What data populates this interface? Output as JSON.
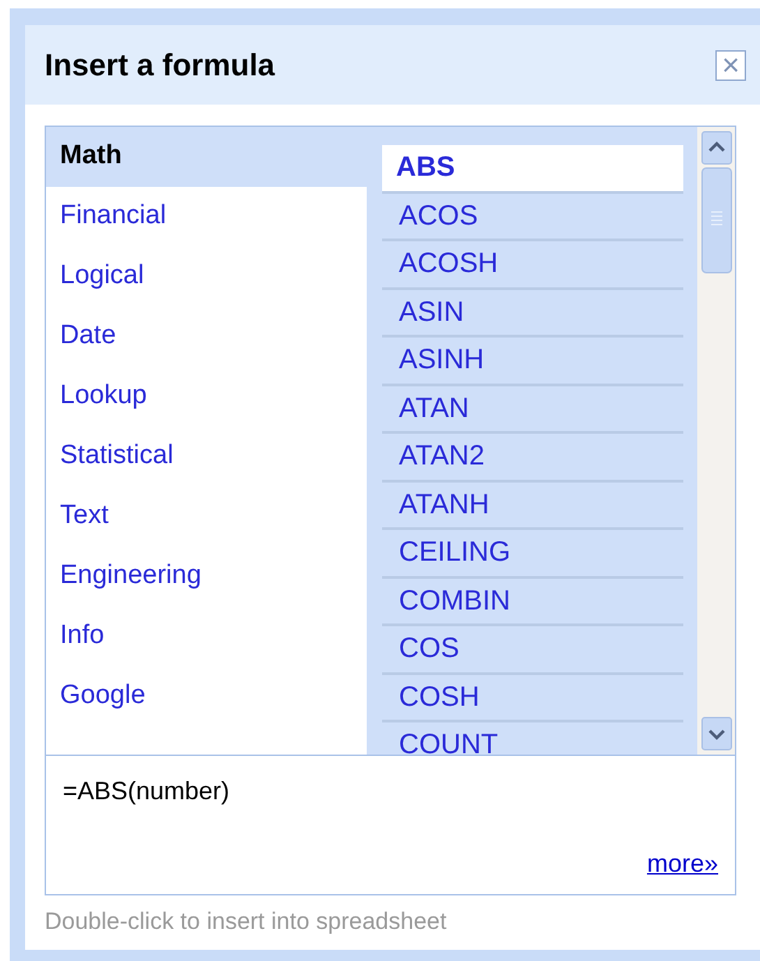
{
  "dialog": {
    "title": "Insert a formula",
    "close": "×"
  },
  "categories": [
    {
      "label": "Math",
      "selected": true
    },
    {
      "label": "Financial",
      "selected": false
    },
    {
      "label": "Logical",
      "selected": false
    },
    {
      "label": "Date",
      "selected": false
    },
    {
      "label": "Lookup",
      "selected": false
    },
    {
      "label": "Statistical",
      "selected": false
    },
    {
      "label": "Text",
      "selected": false
    },
    {
      "label": "Engineering",
      "selected": false
    },
    {
      "label": "Info",
      "selected": false
    },
    {
      "label": "Google",
      "selected": false
    }
  ],
  "functions": [
    {
      "label": "ABS",
      "selected": true
    },
    {
      "label": "ACOS",
      "selected": false
    },
    {
      "label": "ACOSH",
      "selected": false
    },
    {
      "label": "ASIN",
      "selected": false
    },
    {
      "label": "ASINH",
      "selected": false
    },
    {
      "label": "ATAN",
      "selected": false
    },
    {
      "label": "ATAN2",
      "selected": false
    },
    {
      "label": "ATANH",
      "selected": false
    },
    {
      "label": "CEILING",
      "selected": false
    },
    {
      "label": "COMBIN",
      "selected": false
    },
    {
      "label": "COS",
      "selected": false
    },
    {
      "label": "COSH",
      "selected": false
    },
    {
      "label": "COUNT",
      "selected": false
    }
  ],
  "details": {
    "syntax": "=ABS(number)",
    "more_link": "more»"
  },
  "hint": "Double-click to insert into spreadsheet"
}
